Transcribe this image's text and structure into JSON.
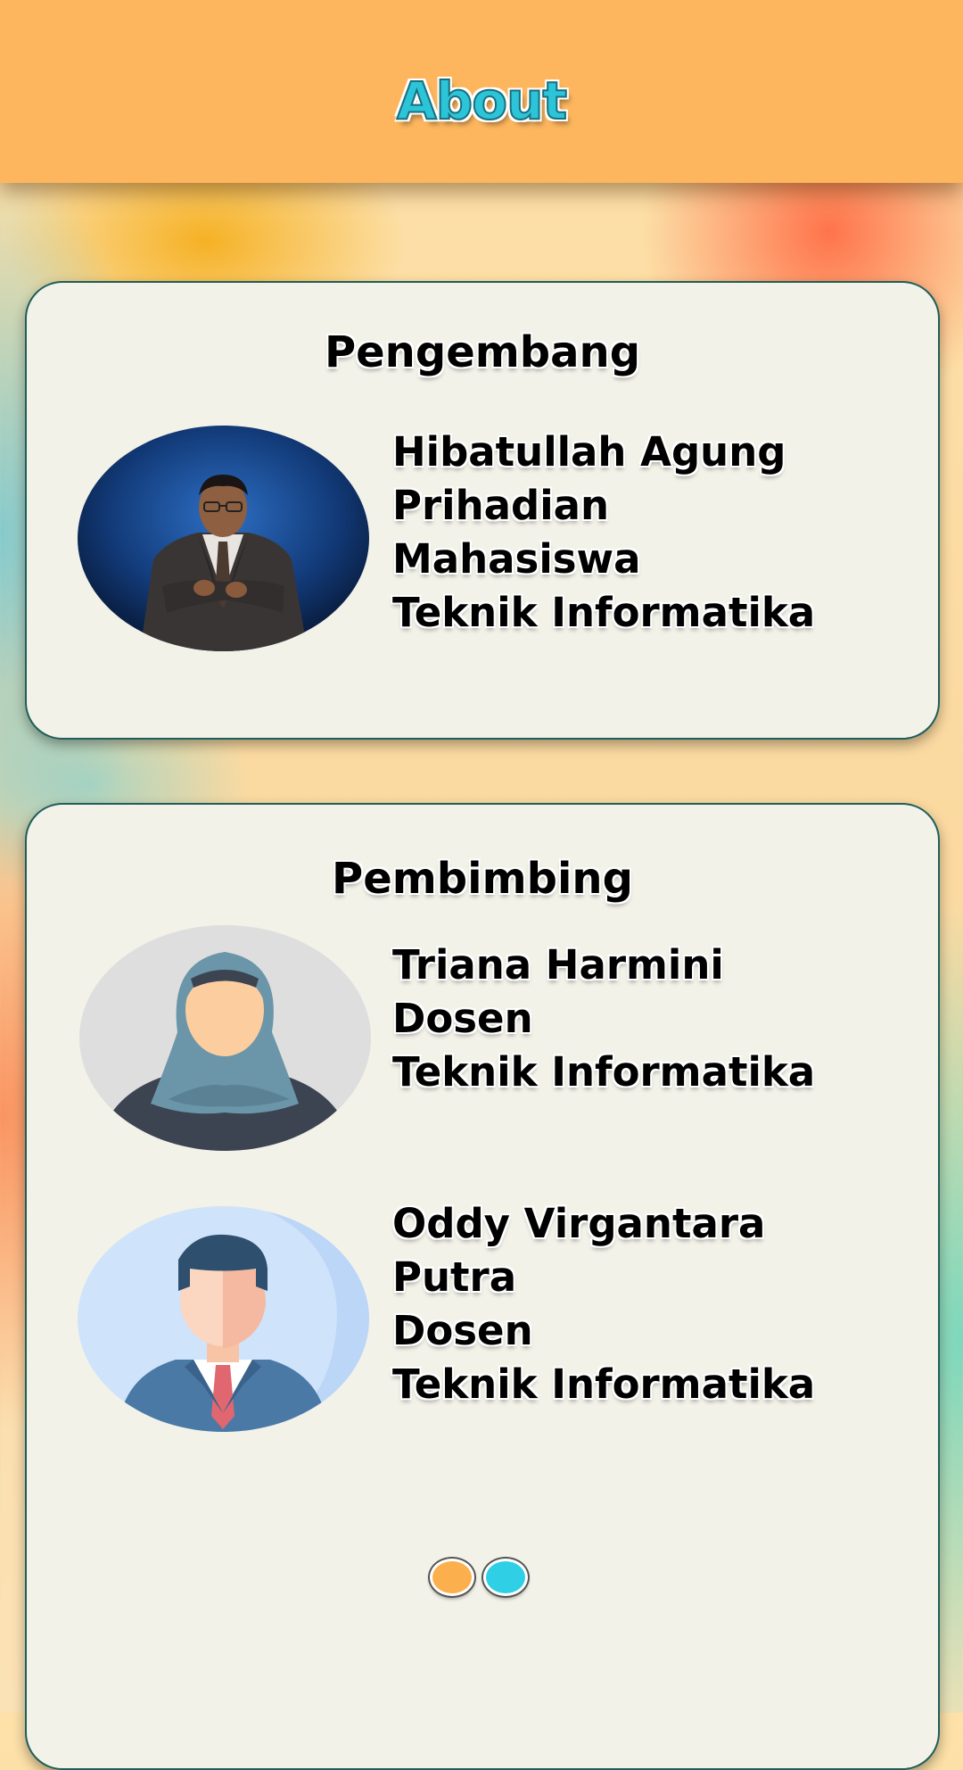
{
  "header": {
    "title": "About"
  },
  "developer_section": {
    "title": "Pengembang",
    "person": {
      "name_line1": "Hibatullah Agung",
      "name_line2": "Prihadian",
      "role": "Mahasiswa",
      "department": "Teknik Informatika",
      "photo_icon": "developer-photo"
    }
  },
  "supervisor_section": {
    "title": "Pembimbing",
    "people": [
      {
        "name_line1": "Triana Harmini",
        "role": "Dosen",
        "department": "Teknik Informatika",
        "avatar_icon": "female-hijab-avatar"
      },
      {
        "name_line1": "Oddy Virgantara",
        "name_line2": "Putra",
        "role": "Dosen",
        "department": "Teknik Informatika",
        "avatar_icon": "male-avatar"
      }
    ]
  },
  "pager": {
    "pages": 2,
    "active_colors": [
      "#fbb04d",
      "#2fd0e6"
    ]
  },
  "colors": {
    "header": "#fdb65e",
    "card": "#f2f2e9",
    "title_accent": "#2cc4d8"
  }
}
